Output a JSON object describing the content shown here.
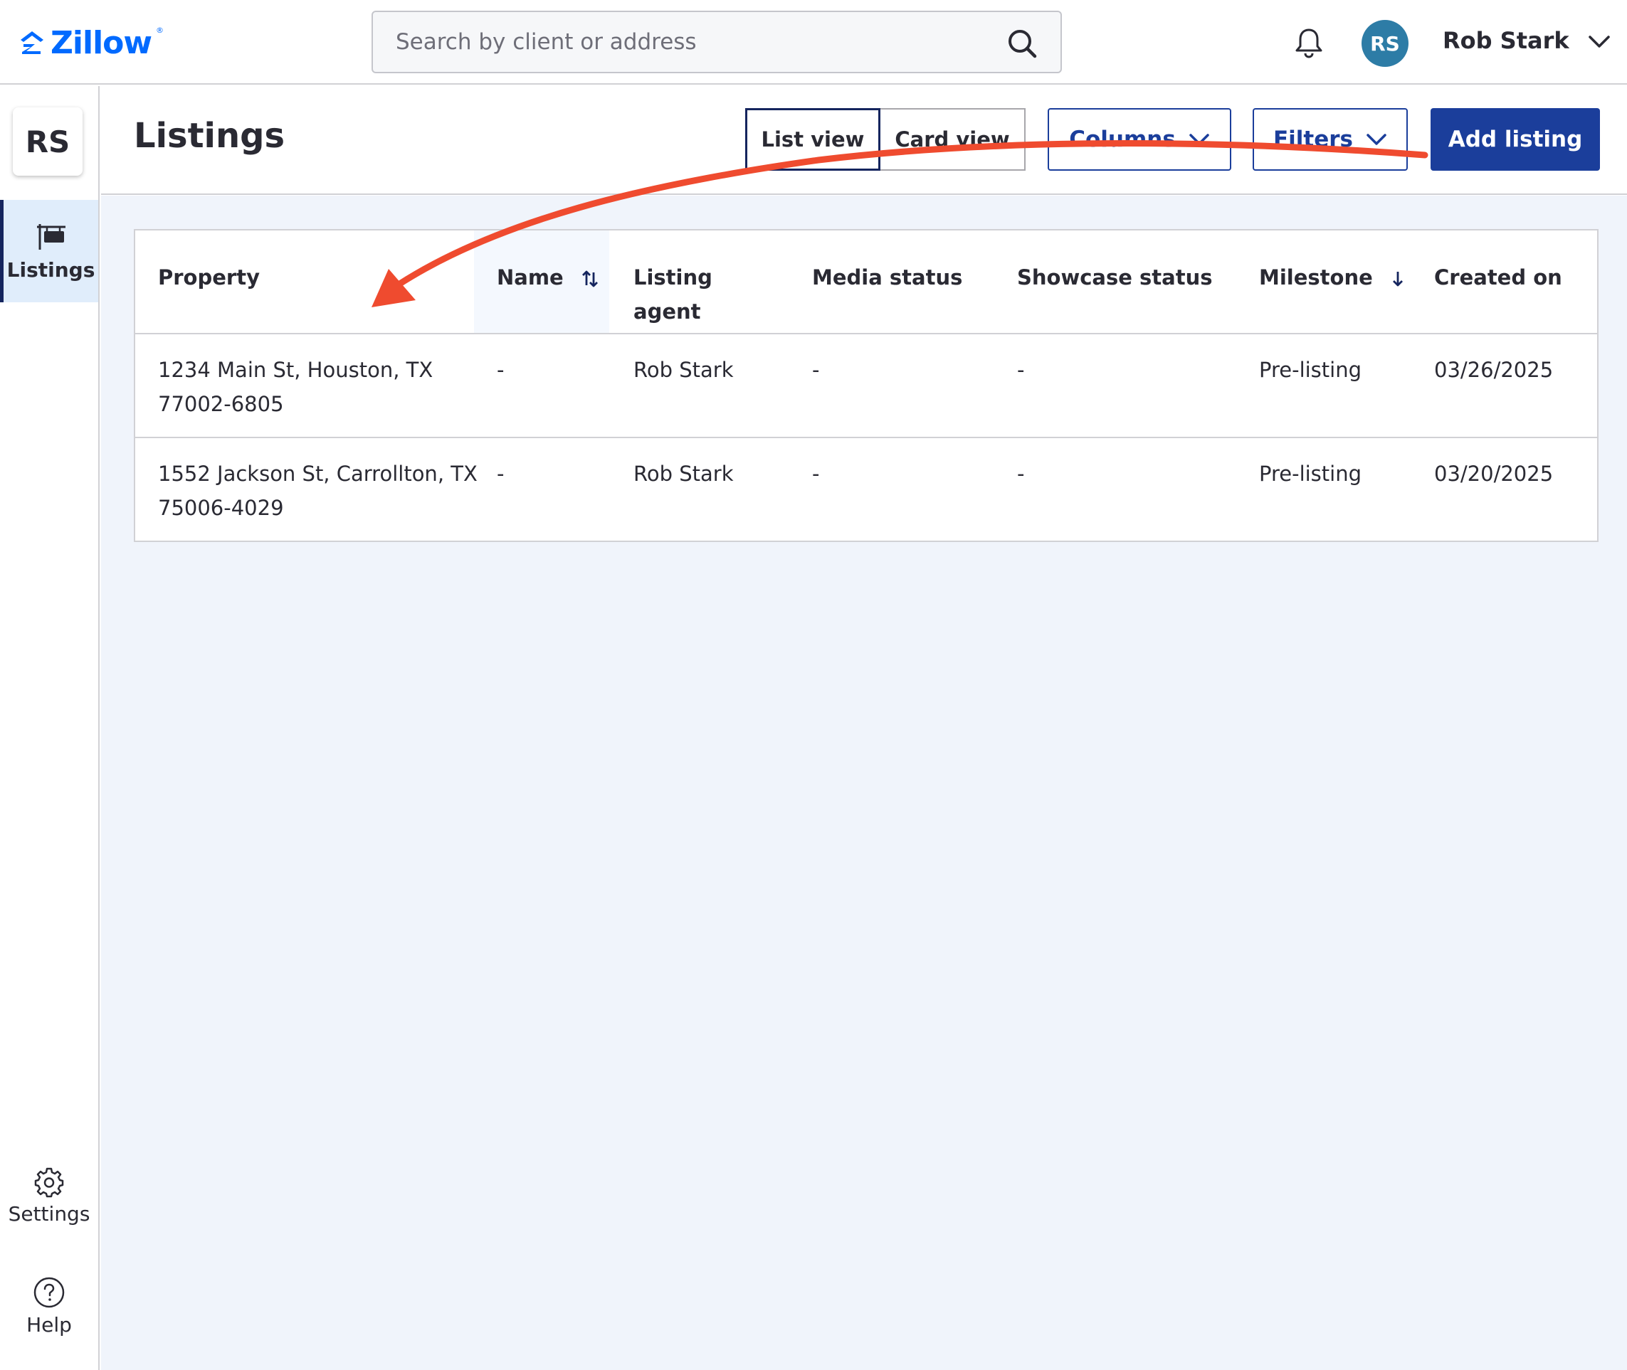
{
  "header": {
    "logo_text": "Zillow",
    "logo_reg": "®",
    "search_placeholder": "Search by client or address",
    "avatar_initials": "RS",
    "user_name": "Rob Stark"
  },
  "sidebar": {
    "org_initials": "RS",
    "items": [
      {
        "label": "Listings",
        "icon": "signpost-icon",
        "active": true
      },
      {
        "label": "Settings",
        "icon": "gear-icon"
      },
      {
        "label": "Help",
        "icon": "help-circle-icon"
      }
    ]
  },
  "page": {
    "title": "Listings",
    "view_toggle": {
      "list_label": "List view",
      "card_label": "Card view",
      "selected": "List view"
    },
    "columns_label": "Columns",
    "filters_label": "Filters",
    "add_label": "Add listing"
  },
  "table": {
    "columns": [
      {
        "key": "property",
        "label": "Property",
        "line2": ""
      },
      {
        "key": "name",
        "label": "Name",
        "line2": "",
        "sort": "sortable"
      },
      {
        "key": "agent",
        "label": "Listing",
        "line2": "agent"
      },
      {
        "key": "media",
        "label": "Media status",
        "line2": ""
      },
      {
        "key": "showcase",
        "label": "Showcase status",
        "line2": ""
      },
      {
        "key": "milestone",
        "label": "Milestone",
        "line2": "",
        "sort": "descending"
      },
      {
        "key": "created",
        "label": "Created on",
        "line2": ""
      }
    ],
    "rows": [
      {
        "property_line1": "1234 Main St, Houston, TX",
        "property_line2": "77002-6805",
        "name": "-",
        "agent": "Rob Stark",
        "media": "-",
        "showcase": "-",
        "milestone": "Pre-listing",
        "created": "03/26/2025"
      },
      {
        "property_line1": "1552 Jackson St, Carrollton, TX",
        "property_line2": "75006-4029",
        "name": "-",
        "agent": "Rob Stark",
        "media": "-",
        "showcase": "-",
        "milestone": "Pre-listing",
        "created": "03/20/2025"
      }
    ]
  },
  "colors": {
    "brand_blue": "#006aff",
    "primary_button": "#1b3e9b",
    "annotation_arrow": "#ef4b2f",
    "content_bg": "#f0f4fb"
  }
}
